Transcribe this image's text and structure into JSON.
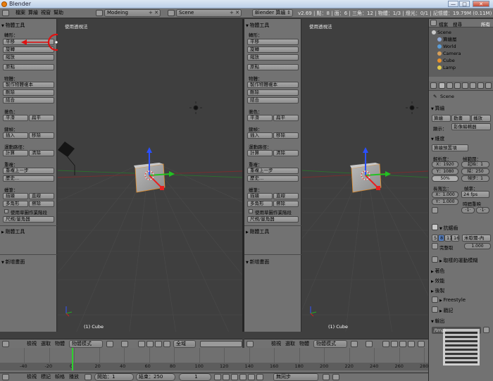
{
  "window": {
    "title": "Blender",
    "min_label": "—",
    "max_label": "□",
    "close_label": "✕"
  },
  "infobar": {
    "menus": [
      "檔案",
      "算繪",
      "視窗",
      "幫助"
    ],
    "layout": "Modeing",
    "scene": "Scene",
    "engine": "Blender 算繪",
    "stats": "v2.69 | 點：8 | 面：6 | 三角：12 | 物體：1/3 | 燈光：0/1 | 記憶體：19.79M (0.11M) | Cube"
  },
  "toolshelf": {
    "header": "物體工具",
    "transform_label": "轉形：",
    "translate": "平移",
    "rotate": "旋轉",
    "scale": "縮放",
    "mirror": "原點",
    "object_label": "物體：",
    "duplicate": "製作物體複本",
    "delete": "刪除",
    "join": "結合",
    "shading_label": "著色：",
    "smooth": "平滑",
    "flat": "扁平",
    "keyframes_label": "鍵幀：",
    "insert": "插入",
    "remove": "移除",
    "motion_label": "運動路徑：",
    "calculate": "計算",
    "clear": "清除",
    "repeat_label": "重複：",
    "repeat_last": "重複上一步",
    "history": "歷史...",
    "grease_label": "蠟筆：",
    "draw": "描繪",
    "line": "直線",
    "poly": "多角形",
    "erase": "擦除",
    "sketch": "使用草圖作業階段",
    "ruler": "尺規/量角器",
    "rigid_body": "剛體工具",
    "new_item": "新增畫面"
  },
  "viewports": {
    "left": {
      "label": "使用透視法",
      "object": "(1) Cube"
    },
    "right": {
      "label": "使用透視法",
      "object": "(1) Cube"
    }
  },
  "viewport_header": {
    "menus": [
      "檢視",
      "選取",
      "物體"
    ],
    "mode": "物體模式",
    "pivot": "全域"
  },
  "timeline": {
    "ticks": [
      "-40",
      "-20",
      "0",
      "20",
      "40",
      "60",
      "80",
      "100",
      "120",
      "140",
      "160",
      "180",
      "200",
      "220",
      "240",
      "260",
      "280"
    ],
    "menus": [
      "檢視",
      "標記",
      "幀格",
      "播放"
    ],
    "start_label": "開始：1",
    "end_label": "結束：250",
    "current": "1",
    "sync": "無同步"
  },
  "outliner": {
    "items": [
      "Scene",
      "算繪層",
      "World",
      "Camera",
      "Cube",
      "Lamp"
    ],
    "search_placeholder": "搜尋",
    "view": "所有"
  },
  "properties": {
    "scene_label": "Scene",
    "render": "算繪",
    "render_btn": "算繪",
    "anim_btn": "動畫",
    "play_btn": "播放",
    "display_label": "顯示：",
    "display_value": "影像編輯器",
    "dimensions": "維度",
    "preset": "算繪預置項",
    "resolution": "解析度：",
    "framerange": "幀範圍：",
    "res_x": "X：1920",
    "res_y": "Y：1080",
    "res_pct": "50%",
    "start": "起始：1",
    "end": "結：250",
    "step": "幀步：1",
    "aspect": "長寬比：",
    "framerate": "幀率：",
    "asp_x": "X：1.000",
    "asp_y": "Y：1.000",
    "fps": "24 fps",
    "time_remap": "時間重映",
    "remap_old": "·1·",
    "remap_new": "·1·",
    "antialias": "抗鋸齒",
    "aa_values": [
      "5",
      "8",
      "11",
      "16"
    ],
    "aa_filter": "米歇爾-內",
    "full_sample": "完整取",
    "aa_size": "1.000",
    "sampled_motion": "取樣的運動模糊",
    "shading": "著色",
    "performance": "效能",
    "post": "後製",
    "freestyle": "Freestyle",
    "stamp": "戳記",
    "output": "輸出",
    "output_path": "/tmp\\"
  }
}
